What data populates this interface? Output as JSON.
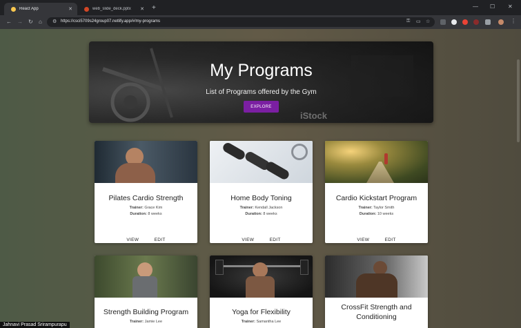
{
  "browser": {
    "tabs": [
      {
        "title": "React App",
        "favicon_color": "#f9c74f"
      },
      {
        "title": "web_slide_deck.pptx",
        "favicon_color": "#d24726"
      }
    ],
    "close_glyph": "✕",
    "new_tab": "+",
    "window_controls": {
      "minimize": "—",
      "maximize": "☐",
      "close": "✕"
    },
    "nav": {
      "back": "←",
      "forward": "→",
      "reload": "↻",
      "home": "⌂"
    },
    "url": "https://csci5709s24group07.netlify.app/#/my-programs",
    "toolbar_icons": [
      "key-icon",
      "cast-icon",
      "star-icon"
    ]
  },
  "hero": {
    "title": "My Programs",
    "subtitle": "List of Programs offered by the Gym",
    "button": "EXPLORE",
    "watermark": "iStock"
  },
  "labels": {
    "trainer": "Trainer:",
    "duration": "Duration:"
  },
  "cards": [
    {
      "title": "Pilates Cardio Strength",
      "trainer": "Grace Kim",
      "duration": "8 weeks",
      "view": "VIEW",
      "edit": "EDIT"
    },
    {
      "title": "Home Body Toning",
      "trainer": "Kendall Jackson",
      "duration": "8 weeks",
      "view": "VIEW",
      "edit": "EDIT"
    },
    {
      "title": "Cardio Kickstart Program",
      "trainer": "Taylor Smith",
      "duration": "10 weeks",
      "view": "VIEW",
      "edit": "EDIT"
    },
    {
      "title": "Strength Building Program",
      "trainer": "Jamie Lee"
    },
    {
      "title": "Yoga for Flexibility",
      "trainer": "Samantha Lee"
    },
    {
      "title": "CrossFit Strength and Conditioning"
    }
  ],
  "caption": "Jahnavi Prasad Srirampurapu"
}
